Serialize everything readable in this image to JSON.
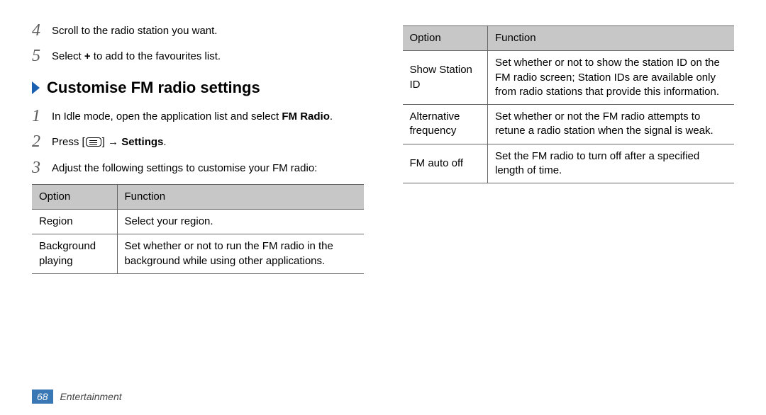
{
  "leftCol": {
    "steps_top": [
      {
        "num": "4",
        "text": "Scroll to the radio station you want."
      },
      {
        "num": "5",
        "pre": "Select ",
        "bold": "+",
        "post": " to add to the favourites list."
      }
    ],
    "heading": "Customise FM radio settings",
    "steps_bottom": [
      {
        "num": "1",
        "pre": "In Idle mode, open the application list and select ",
        "bold": "FM Radio",
        "post": "."
      },
      {
        "num": "2",
        "pre": "Press [",
        "icon": true,
        "mid": "] → ",
        "bold": "Settings",
        "post": "."
      },
      {
        "num": "3",
        "text": "Adjust the following settings to customise your FM radio:"
      }
    ],
    "table": {
      "head": [
        "Option",
        "Function"
      ],
      "rows": [
        [
          "Region",
          "Select your region."
        ],
        [
          "Background playing",
          "Set whether or not to run the FM radio in the background while using other applications."
        ]
      ]
    }
  },
  "rightCol": {
    "table": {
      "head": [
        "Option",
        "Function"
      ],
      "rows": [
        [
          "Show Station ID",
          "Set whether or not to show the station ID on the FM radio screen; Station IDs are available only from radio stations that provide this information."
        ],
        [
          "Alternative frequency",
          "Set whether or not the FM radio attempts to retune a radio station when the signal is weak."
        ],
        [
          "FM auto off",
          "Set the FM radio to turn off after a specified length of time."
        ]
      ]
    }
  },
  "footer": {
    "page": "68",
    "section": "Entertainment"
  }
}
